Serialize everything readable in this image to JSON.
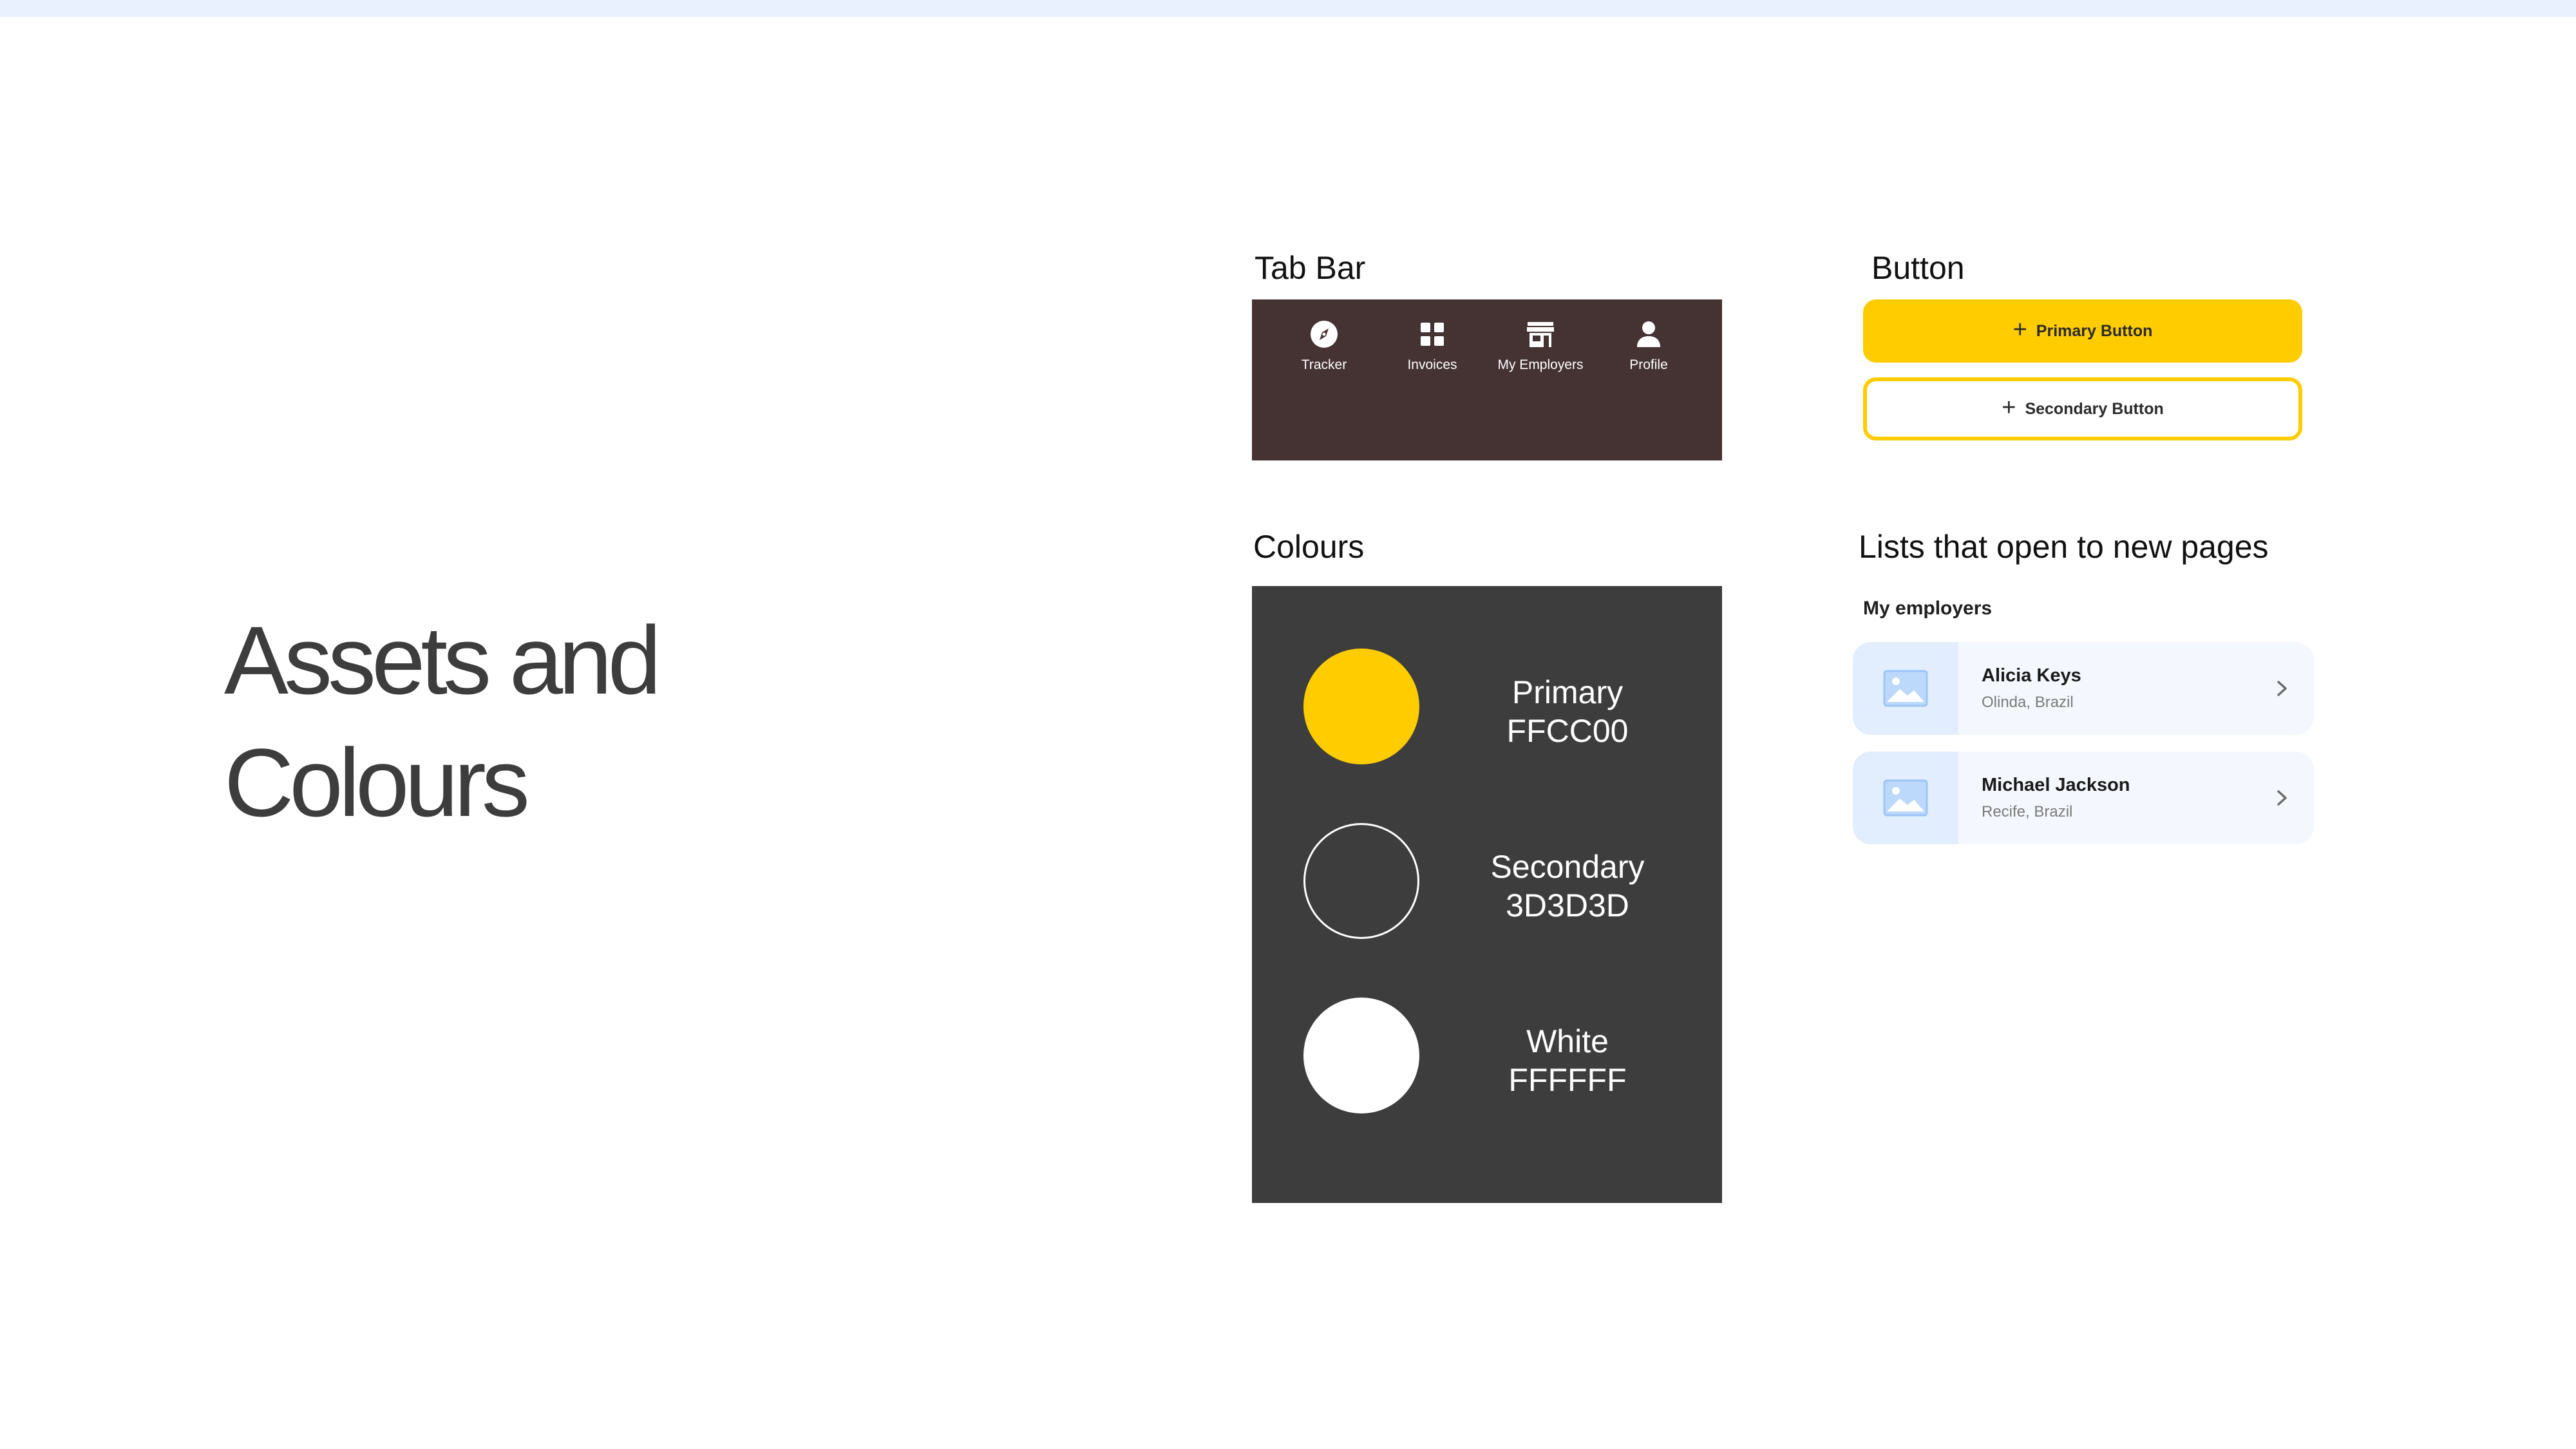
{
  "hero": {
    "line1": "Assets and",
    "line2": "Colours"
  },
  "sections": {
    "tab_bar": "Tab Bar",
    "button": "Button",
    "colours": "Colours",
    "lists": "Lists that open to new pages"
  },
  "tab_bar": {
    "background": "#453333",
    "items": [
      {
        "label": "Tracker",
        "icon": "compass-icon"
      },
      {
        "label": "Invoices",
        "icon": "grid-icon"
      },
      {
        "label": "My Employers",
        "icon": "store-icon"
      },
      {
        "label": "Profile",
        "icon": "person-icon"
      }
    ]
  },
  "buttons": {
    "primary_label": "Primary Button",
    "secondary_label": "Secondary Button",
    "icon": "plus-icon"
  },
  "colours": {
    "background": "#3D3D3D",
    "swatches": [
      {
        "name": "Primary",
        "hex": "FFCC00",
        "color": "#FFCC00"
      },
      {
        "name": "Secondary",
        "hex": "3D3D3D",
        "color": "#3D3D3D"
      },
      {
        "name": "White",
        "hex": "FFFFFF",
        "color": "#FFFFFF"
      }
    ]
  },
  "lists": {
    "heading": "My employers",
    "items": [
      {
        "name": "Alicia Keys",
        "location": "Olinda, Brazil",
        "icon": "image-placeholder-icon"
      },
      {
        "name": "Michael Jackson",
        "location": "Recife, Brazil",
        "icon": "image-placeholder-icon"
      }
    ]
  }
}
